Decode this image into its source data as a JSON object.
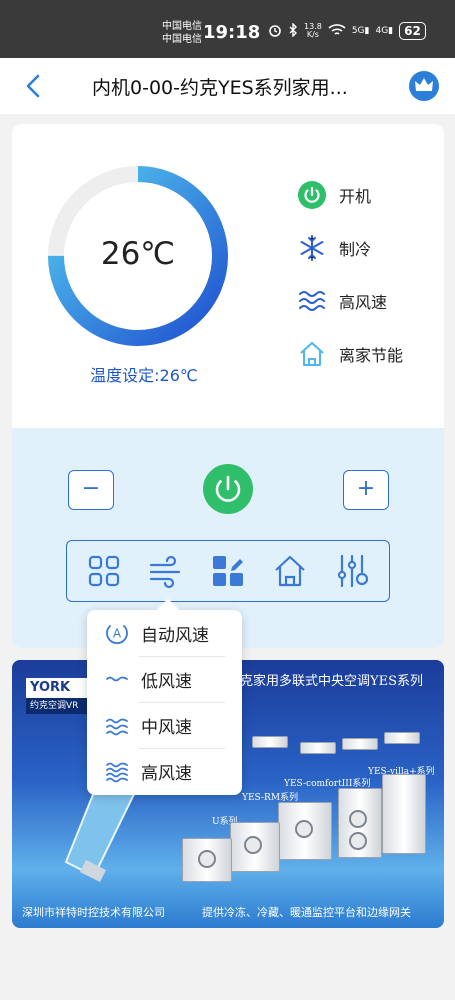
{
  "status_bar": {
    "carrier_1": "中国电信",
    "carrier_2": "中国电信",
    "time": "19:18",
    "net_speed_top": "13.8",
    "net_speed_bottom": "K/s",
    "signal_5g": "5G",
    "signal_4g": "4G",
    "battery": "62"
  },
  "nav": {
    "title": "内机0-00-约克YES系列家用..."
  },
  "climate": {
    "current_temp": "26℃",
    "setpoint_label": "温度设定:26℃",
    "gauge_fraction": 0.75,
    "accent": "#2a5fd1",
    "status_items": [
      {
        "icon": "power-icon",
        "label": "开机"
      },
      {
        "icon": "snowflake-icon",
        "label": "制冷"
      },
      {
        "icon": "wind-icon",
        "label": "高风速"
      },
      {
        "icon": "home-icon",
        "label": "离家节能"
      }
    ]
  },
  "controls": {
    "minus_label": "−",
    "plus_label": "+",
    "toolbar_icons": [
      "mode-grid-icon",
      "fan-speed-icon",
      "settings-tiles-icon",
      "home-icon",
      "adjust-sliders-icon"
    ]
  },
  "fan_menu": {
    "items": [
      {
        "icon": "auto-a-icon",
        "label": "自动风速"
      },
      {
        "icon": "wave-low-icon",
        "label": "低风速"
      },
      {
        "icon": "wave-mid-icon",
        "label": "中风速"
      },
      {
        "icon": "wave-high-icon",
        "label": "高风速"
      }
    ]
  },
  "banner": {
    "logo": "YORK",
    "logo_sub": "约克空调VR",
    "headline": "克家用多联式中央空调YES系列",
    "series_1": "YES-villa+系列",
    "series_2": "YES-comfortIII系列",
    "series_3": "YES-RM系列",
    "series_4": "U系列",
    "footer_left": "深圳市祥特时控技术有限公司",
    "footer_right": "提供冷冻、冷藏、暖通监控平台和边缘网关"
  }
}
